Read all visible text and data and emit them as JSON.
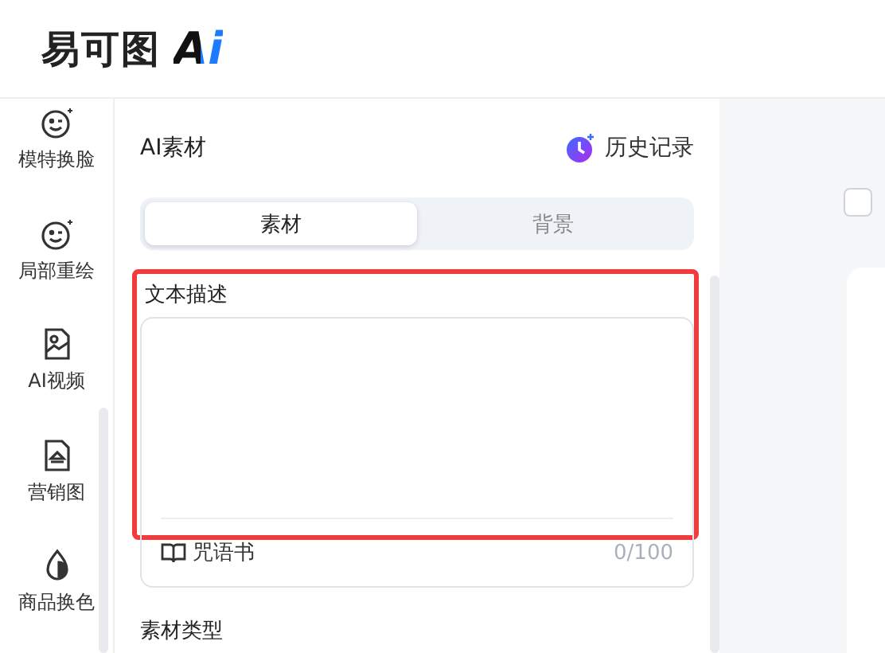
{
  "logo": {
    "name": "易可图",
    "mark": "Ai"
  },
  "sidebar": {
    "items": [
      {
        "label": "模特换脸"
      },
      {
        "label": "局部重绘"
      },
      {
        "label": "AI视频"
      },
      {
        "label": "营销图"
      },
      {
        "label": "商品换色"
      }
    ]
  },
  "panel": {
    "title": "AI素材",
    "history": "历史记录",
    "tabs": [
      {
        "label": "素材",
        "selected": true
      },
      {
        "label": "背景",
        "selected": false
      }
    ],
    "text_description": {
      "label": "文本描述",
      "highlighted": true,
      "spellbook": "咒语书",
      "counter": "0/100"
    },
    "material_type": {
      "label": "素材类型"
    }
  },
  "canvas": {
    "checkbox": {
      "checked": false
    }
  }
}
